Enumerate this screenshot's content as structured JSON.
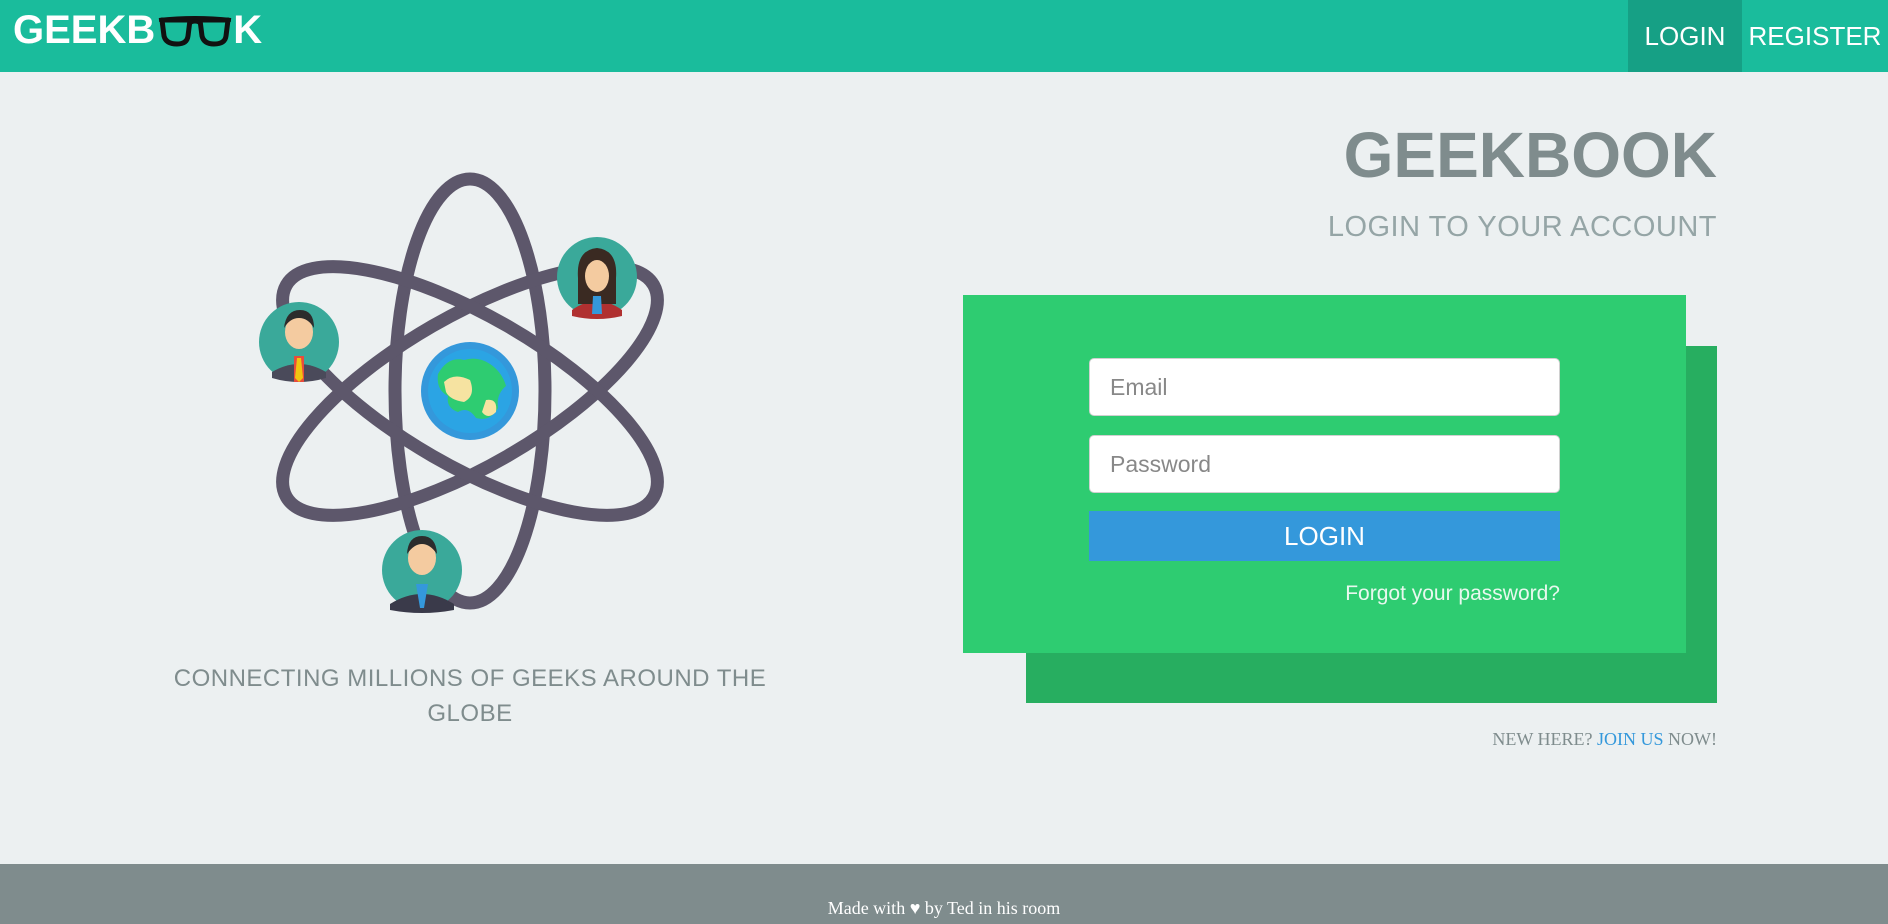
{
  "navbar": {
    "brand_prefix": "GEEKB",
    "brand_suffix": "K",
    "links": {
      "login": "LOGIN",
      "register": "REGISTER"
    }
  },
  "hero": {
    "tagline": "CONNECTING MILLIONS OF GEEKS AROUND THE GLOBE"
  },
  "login": {
    "title": "GEEKBOOK",
    "subtitle": "LOGIN TO YOUR ACCOUNT",
    "email_placeholder": "Email",
    "password_placeholder": "Password",
    "button_label": "LOGIN",
    "forgot_link": "Forgot your password?",
    "new_here_prefix": "NEW HERE? ",
    "join_link": "JOIN US",
    "new_here_suffix": " NOW!"
  },
  "footer": {
    "text": "Made with ♥ by Ted in his room"
  },
  "colors": {
    "navbar": "#1abc9c",
    "nav_active": "#16a085",
    "card": "#2ecc71",
    "card_shadow": "#27ae60",
    "button": "#3498db",
    "footer": "#7f8c8d",
    "background": "#ecf0f1"
  },
  "icons": [
    "glasses-icon",
    "atom-illustration",
    "globe-icon",
    "avatar-man-icon",
    "avatar-woman-icon",
    "avatar-businessman-icon"
  ]
}
